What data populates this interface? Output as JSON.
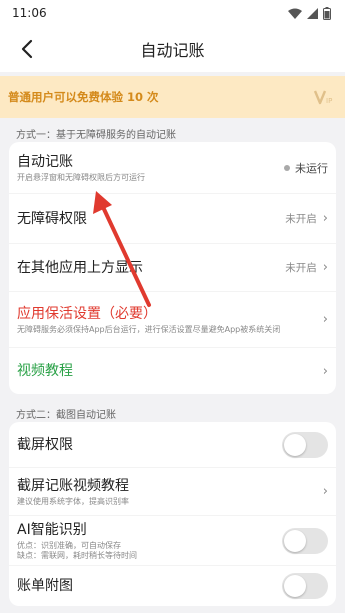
{
  "status_bar": {
    "time": "11:06"
  },
  "header": {
    "title": "自动记账"
  },
  "banner": {
    "text": "普通用户可以免费体验 10 次",
    "icon": "vip-icon"
  },
  "section1": {
    "label": "方式一：基于无障碍服务的自动记账",
    "auto_bookkeeping": {
      "title": "自动记账",
      "subtitle": "开启悬浮窗和无障碍权限后方可运行",
      "status": "未运行"
    },
    "accessibility": {
      "title": "无障碍权限",
      "status": "未开启"
    },
    "overlay": {
      "title": "在其他应用上方显示",
      "status": "未开启"
    },
    "keepalive": {
      "title": "应用保活设置（必要）",
      "subtitle": "无障碍服务必须保持App后台运行，进行保活设置尽量避免App被系统关闭"
    },
    "video": {
      "title": "视频教程"
    }
  },
  "section2": {
    "label": "方式二：截图自动记账",
    "screenshot_perm": {
      "title": "截屏权限"
    },
    "screenshot_video": {
      "title": "截屏记账视频教程",
      "subtitle": "建议使用系统字体，提高识别率"
    },
    "ai": {
      "title": "AI智能识别",
      "subtitle": "优点：识别准确，可自动保存\n缺点：需联网，耗时稍长等待时间"
    },
    "attach": {
      "title": "账单附图"
    }
  },
  "colors": {
    "banner_bg": "#fde9c3",
    "banner_text": "#d48a1b",
    "warning": "#e03a2f",
    "link": "#2aa147",
    "arrow": "#e03a2f"
  }
}
